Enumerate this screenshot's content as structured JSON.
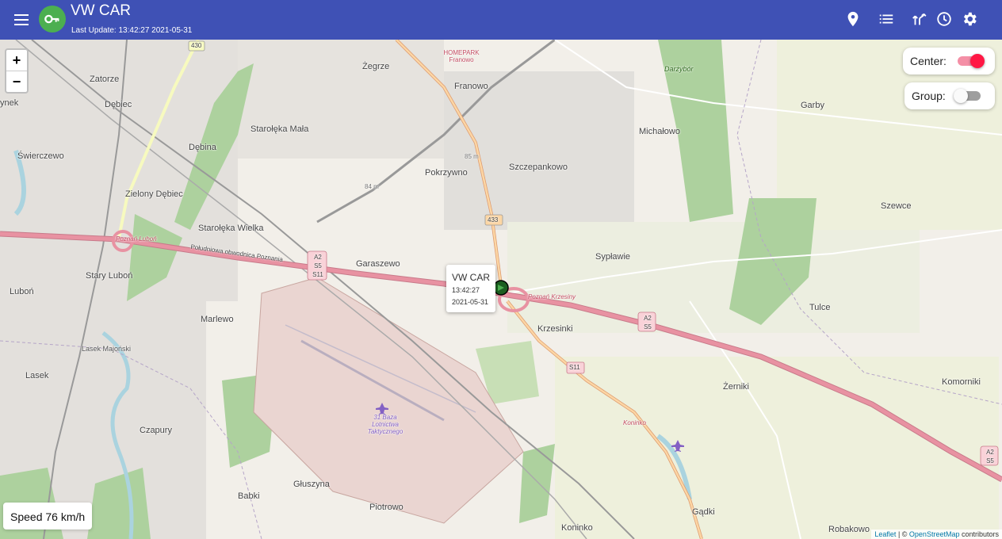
{
  "header": {
    "title": "VW CAR",
    "last_update": "Last Update: 13:42:27 2021-05-31",
    "icons": [
      "menu-icon",
      "key-icon",
      "location-pin-icon",
      "list-icon",
      "route-icon",
      "clock-icon",
      "gear-icon"
    ]
  },
  "map": {
    "zoom_in": "+",
    "zoom_out": "−",
    "places": [
      "Zatorze",
      "Dębiec",
      "Świerczewo",
      "Dębina",
      "Zielony Dębiec",
      "Starołęka Mała",
      "Żegrze",
      "Franowo",
      "Pokrzywno",
      "Szczepankowo",
      "Michałowo",
      "Garby",
      "Szewce",
      "Starołęka Wielka",
      "Garaszewo",
      "Stary Luboń",
      "Luboń",
      "Marlewo",
      "Sypławie",
      "Krzesinki",
      "Tulce",
      "Lasek Majoński",
      "Lasek",
      "Czapury",
      "Żerniki",
      "Komorniki",
      "Babki",
      "Głuszyna",
      "Piotrowo",
      "Koninko",
      "Gądki",
      "Robakowo",
      "Darżybór",
      "ynek"
    ],
    "roads": [
      "430",
      "433",
      "85 m",
      "84 m",
      "Poznań Luboń",
      "Południowa obwodnica Poznania",
      "Poznań Krzesiny",
      "S11",
      "A2 S5 S11",
      "A2 S5",
      "HOMEPARK Franowo",
      "31 Baza Lotnictwa Taktycznego",
      "Koninko"
    ],
    "attribution": {
      "leaflet": "Leaflet",
      "separator": " | © ",
      "osm": "OpenStreetMap",
      "suffix": " contributors"
    }
  },
  "controls": {
    "center_label": "Center:",
    "center_on": true,
    "group_label": "Group:",
    "group_on": false
  },
  "popup": {
    "name": "VW CAR",
    "time": "13:42:27",
    "date": "2021-05-31"
  },
  "speed": "Speed 76 km/h",
  "colors": {
    "primary": "#3f51b5",
    "avatar": "#4caf50",
    "toggle_on": "#ff1744",
    "marker": "#1b5e20",
    "motorway": "#e892a2"
  }
}
